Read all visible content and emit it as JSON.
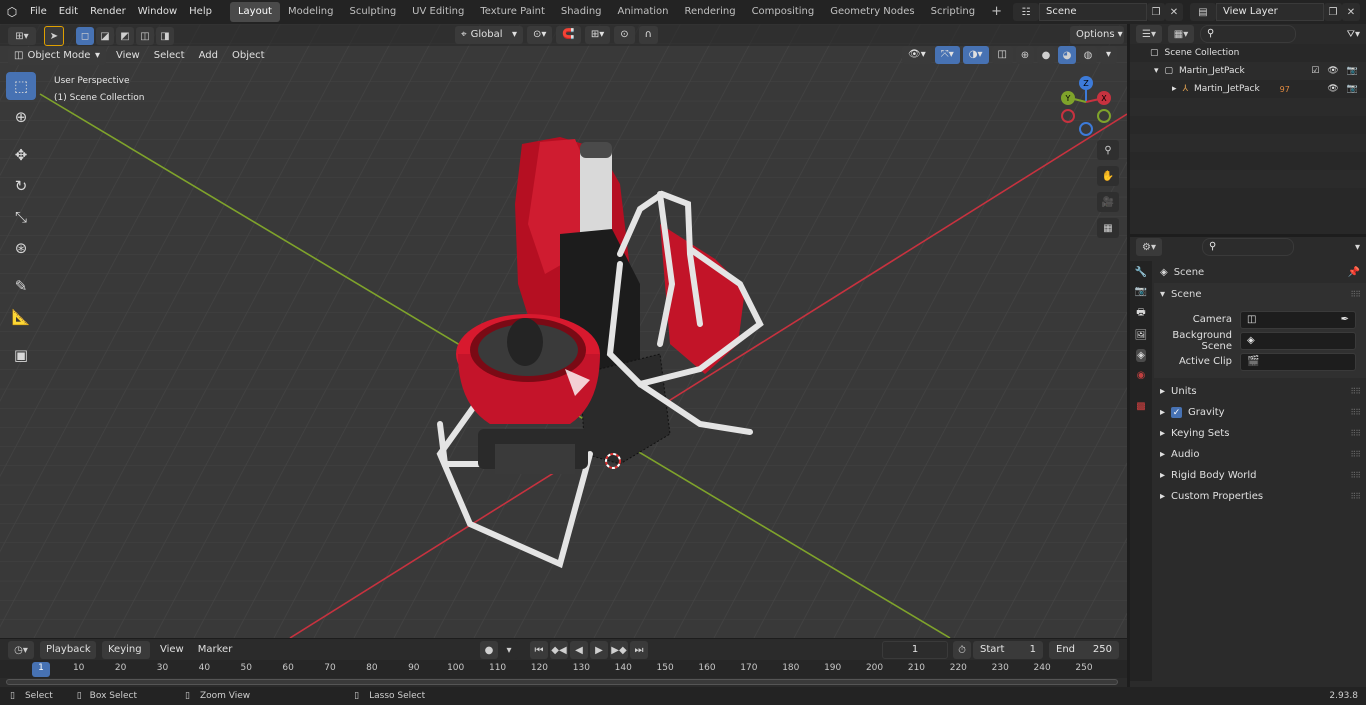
{
  "topbar": {
    "menus": [
      "File",
      "Edit",
      "Render",
      "Window",
      "Help"
    ],
    "workspaces": [
      "Layout",
      "Modeling",
      "Sculpting",
      "UV Editing",
      "Texture Paint",
      "Shading",
      "Animation",
      "Rendering",
      "Compositing",
      "Geometry Nodes",
      "Scripting"
    ],
    "active_workspace": "Layout",
    "scene_name": "Scene",
    "view_layer_name": "View Layer"
  },
  "viewport_header": {
    "transform_orientation": "Global",
    "options_label": "Options",
    "mode": "Object Mode",
    "menus": [
      "View",
      "Select",
      "Add",
      "Object"
    ]
  },
  "viewport": {
    "perspective_label": "User Perspective",
    "collection_label": "(1) Scene Collection",
    "gizmo": {
      "x": "X",
      "y": "Y",
      "z": "Z"
    }
  },
  "outliner": {
    "root": "Scene Collection",
    "collection": "Martin_JetPack",
    "object": "Martin_JetPack",
    "object_badge": "97"
  },
  "properties": {
    "breadcrumb": "Scene",
    "panel_title": "Scene",
    "fields": [
      {
        "label": "Camera",
        "value": ""
      },
      {
        "label": "Background Scene",
        "value": ""
      },
      {
        "label": "Active Clip",
        "value": ""
      }
    ],
    "subpanels": [
      "Units",
      "Gravity",
      "Keying Sets",
      "Audio",
      "Rigid Body World",
      "Custom Properties"
    ],
    "gravity_checked": true
  },
  "timeline": {
    "menus": [
      "Playback",
      "Keying",
      "View",
      "Marker"
    ],
    "current_frame": "1",
    "start_label": "Start",
    "start": "1",
    "end_label": "End",
    "end": "250",
    "ticks": [
      "1",
      "10",
      "20",
      "30",
      "40",
      "50",
      "60",
      "70",
      "80",
      "90",
      "100",
      "110",
      "120",
      "130",
      "140",
      "150",
      "160",
      "170",
      "180",
      "190",
      "200",
      "210",
      "220",
      "230",
      "240",
      "250"
    ]
  },
  "statusbar": {
    "select": "Select",
    "box_select": "Box Select",
    "zoom_view": "Zoom View",
    "lasso_select": "Lasso Select",
    "version": "2.93.8"
  },
  "colors": {
    "accent": "#4772b3",
    "x_axis": "#c7323f",
    "y_axis": "#7fa32b",
    "z_axis": "#3d7bd9",
    "jetpack_red": "#c8102e"
  }
}
